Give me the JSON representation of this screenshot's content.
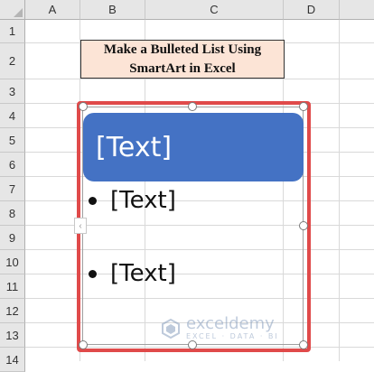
{
  "columns": [
    "A",
    "B",
    "C",
    "D"
  ],
  "rows": [
    "1",
    "2",
    "3",
    "4",
    "5",
    "6",
    "7",
    "8",
    "9",
    "10",
    "11",
    "12",
    "13",
    "14"
  ],
  "title_cell": {
    "line1": "Make a Bulleted List Using",
    "line2": "SmartArt in Excel"
  },
  "smartart": {
    "header_text": "[Text]",
    "bullets": [
      "[Text]",
      "[Text]"
    ],
    "collapse_glyph": "‹",
    "frame_color": "#e04a4a",
    "header_color": "#4472c4"
  },
  "watermark": {
    "name": "exceldemy",
    "tagline": "EXCEL · DATA · BI"
  }
}
